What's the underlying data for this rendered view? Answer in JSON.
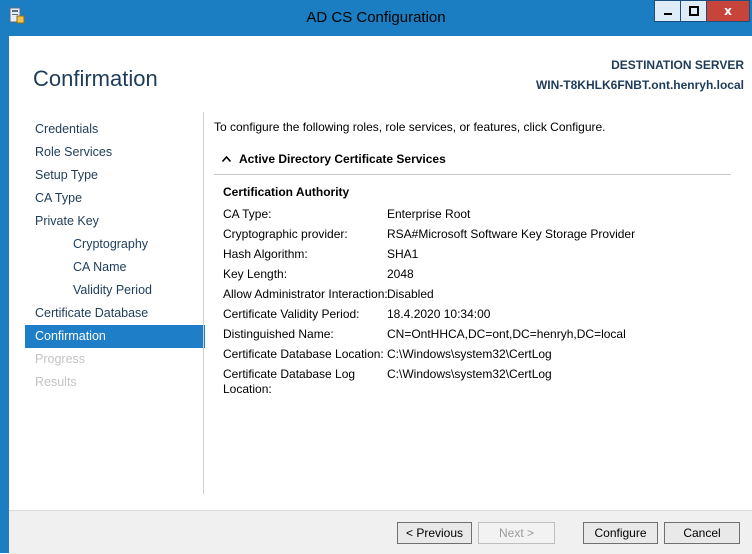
{
  "window": {
    "title": "AD CS Configuration",
    "accent_color": "#1b7ec2",
    "close_glyph": "x",
    "app_icon": "server-config-icon"
  },
  "header": {
    "page_title": "Confirmation",
    "destination_label": "DESTINATION SERVER",
    "destination_server": "WIN-T8KHLK6FNBT.ont.henryh.local"
  },
  "nav": {
    "items": [
      {
        "label": "Credentials",
        "state": "normal"
      },
      {
        "label": "Role Services",
        "state": "normal"
      },
      {
        "label": "Setup Type",
        "state": "normal"
      },
      {
        "label": "CA Type",
        "state": "normal"
      },
      {
        "label": "Private Key",
        "state": "normal"
      },
      {
        "label": "Cryptography",
        "state": "normal"
      },
      {
        "label": "CA Name",
        "state": "normal"
      },
      {
        "label": "Validity Period",
        "state": "normal"
      },
      {
        "label": "Certificate Database",
        "state": "normal"
      },
      {
        "label": "Confirmation",
        "state": "active"
      },
      {
        "label": "Progress",
        "state": "disabled"
      },
      {
        "label": "Results",
        "state": "disabled"
      }
    ]
  },
  "main": {
    "intro": "To configure the following roles, role services, or features, click Configure.",
    "section_title": "Active Directory Certificate Services",
    "ca_heading": "Certification Authority",
    "rows": [
      {
        "key": "CA Type:",
        "value": "Enterprise Root"
      },
      {
        "key": "Cryptographic provider:",
        "value": "RSA#Microsoft Software Key Storage Provider"
      },
      {
        "key": "Hash Algorithm:",
        "value": "SHA1"
      },
      {
        "key": "Key Length:",
        "value": "2048"
      },
      {
        "key": "Allow Administrator Interaction:",
        "value": "Disabled"
      },
      {
        "key": "Certificate Validity Period:",
        "value": "18.4.2020 10:34:00"
      },
      {
        "key": "Distinguished Name:",
        "value": "CN=OntHHCA,DC=ont,DC=henryh,DC=local"
      },
      {
        "key": "Certificate Database Location:",
        "value": "C:\\Windows\\system32\\CertLog"
      },
      {
        "key": "Certificate Database Log Location:",
        "value": "C:\\Windows\\system32\\CertLog"
      }
    ]
  },
  "footer": {
    "previous": "< Previous",
    "next": "Next >",
    "configure": "Configure",
    "cancel": "Cancel"
  }
}
